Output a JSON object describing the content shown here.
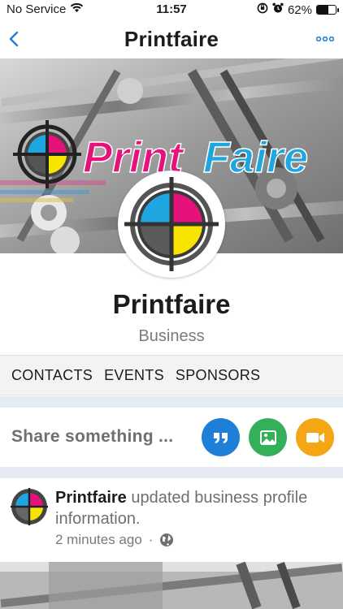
{
  "status_bar": {
    "carrier": "No Service",
    "time": "11:57",
    "battery_percent": "62%",
    "battery_level": 0.62
  },
  "nav": {
    "title": "Printfaire",
    "back_icon": "chevron-left-icon",
    "more_icon": "ellipsis-icon"
  },
  "cover": {
    "logo_text_print": "Print",
    "logo_text_faire": "Faire"
  },
  "profile": {
    "name": "Printfaire",
    "type": "Business"
  },
  "tabs": [
    {
      "label": "CONTACTS"
    },
    {
      "label": "EVENTS"
    },
    {
      "label": "SPONSORS"
    }
  ],
  "share": {
    "prompt": "Share something ...",
    "buttons": [
      {
        "icon": "quote-icon",
        "color": "#1e7fd8"
      },
      {
        "icon": "photo-icon",
        "color": "#34b05a"
      },
      {
        "icon": "video-icon",
        "color": "#f5a614"
      }
    ]
  },
  "post": {
    "author": "Printfaire",
    "action": " updated business profile information.",
    "time_ago": "2 minutes ago",
    "separator": "·",
    "privacy_icon": "globe-icon"
  },
  "colors": {
    "accent": "#1e7fd8",
    "logo_magenta": "#e6127c",
    "logo_cyan": "#1ea6e0",
    "logo_yellow": "#f7e500",
    "band": "#e6ebf3"
  }
}
